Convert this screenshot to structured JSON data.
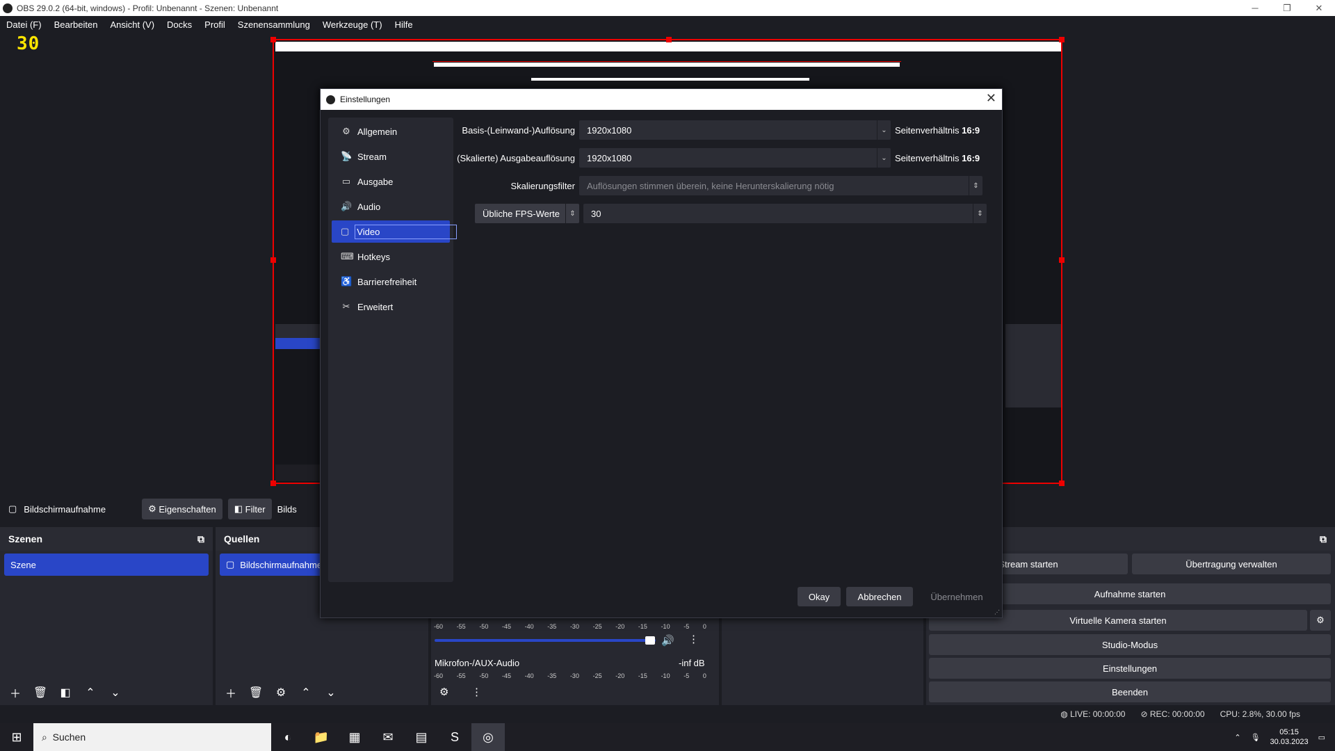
{
  "window": {
    "title": "OBS 29.0.2 (64-bit, windows) - Profil: Unbenannt - Szenen: Unbenannt"
  },
  "menu": [
    "Datei (F)",
    "Bearbeiten",
    "Ansicht (V)",
    "Docks",
    "Profil",
    "Szenensammlung",
    "Werkzeuge (T)",
    "Hilfe"
  ],
  "preview": {
    "fps_overlay": "30"
  },
  "source_bar": {
    "source_name": "Bildschirmaufnahme",
    "properties": "Eigenschaften",
    "filters": "Filter",
    "extra": "Bilds"
  },
  "scenes": {
    "title": "Szenen",
    "items": [
      "Szene"
    ]
  },
  "sources": {
    "title": "Quellen",
    "items": [
      "Bildschirmaufnahme"
    ]
  },
  "mixer": {
    "ticks": [
      "-60",
      "-55",
      "-50",
      "-45",
      "-40",
      "-35",
      "-30",
      "-25",
      "-20",
      "-15",
      "-10",
      "-5",
      "0"
    ],
    "channel2": {
      "name": "Mikrofon-/AUX-Audio",
      "level": "-inf dB"
    }
  },
  "controls": {
    "stream": "Stream starten",
    "manage": "Übertragung verwalten",
    "record": "Aufnahme starten",
    "virtualcam": "Virtuelle Kamera starten",
    "studio": "Studio-Modus",
    "settings": "Einstellungen",
    "exit": "Beenden"
  },
  "status": {
    "live": "LIVE: 00:00:00",
    "rec": "REC: 00:00:00",
    "cpu": "CPU: 2.8%, 30.00 fps"
  },
  "taskbar": {
    "search": "Suchen",
    "time": "05:15",
    "date": "30.03.2023"
  },
  "dialog": {
    "title": "Einstellungen",
    "nav": [
      {
        "label": "Allgemein",
        "icon": "gear-icon",
        "glyph": "⚙"
      },
      {
        "label": "Stream",
        "icon": "antenna-icon",
        "glyph": "📡"
      },
      {
        "label": "Ausgabe",
        "icon": "output-icon",
        "glyph": "▭"
      },
      {
        "label": "Audio",
        "icon": "speaker-icon",
        "glyph": "🔊"
      },
      {
        "label": "Video",
        "icon": "monitor-icon",
        "glyph": "▢"
      },
      {
        "label": "Hotkeys",
        "icon": "keyboard-icon",
        "glyph": "⌨"
      },
      {
        "label": "Barrierefreiheit",
        "icon": "accessibility-icon",
        "glyph": "♿"
      },
      {
        "label": "Erweitert",
        "icon": "tools-icon",
        "glyph": "✂"
      }
    ],
    "active": "Video",
    "base_res_label": "Basis-(Leinwand-)Auflösung",
    "base_res_value": "1920x1080",
    "output_res_label": "(Skalierte) Ausgabeauflösung",
    "output_res_value": "1920x1080",
    "ratio_prefix": "Seitenverhältnis",
    "ratio_value": "16:9",
    "filter_label": "Skalierungsfilter",
    "filter_value": "Auflösungen stimmen überein, keine Herunterskalierung nötig",
    "fps_type": "Übliche FPS-Werte",
    "fps_value": "30",
    "ok": "Okay",
    "cancel": "Abbrechen",
    "apply": "Übernehmen"
  },
  "colors": {
    "accent": "#2946c7",
    "bg": "#1c1d23",
    "panel": "#272830",
    "selection_border": "#ee0000",
    "fps": "#ffe600"
  }
}
